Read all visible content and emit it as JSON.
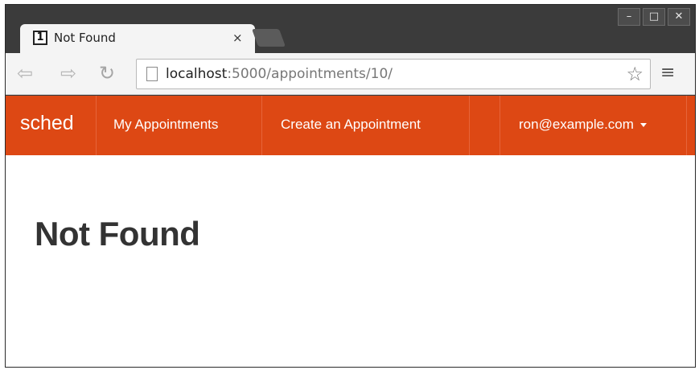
{
  "browser": {
    "tab": {
      "favicon": "1",
      "title": "Not Found",
      "close": "×"
    },
    "window_buttons": [
      "–",
      "□",
      "✕"
    ],
    "nav": {
      "back_icon": "back-icon",
      "forward_icon": "forward-icon",
      "reload_icon": "reload-icon"
    },
    "address": {
      "host": "localhost",
      "rest": ":5000/appointments/10/"
    },
    "bookmark_icon": "☆",
    "menu_icon": "≡"
  },
  "app": {
    "brand": "sched",
    "nav_links": [
      "My Appointments",
      "Create an Appointment"
    ],
    "user": "ron@example.com",
    "accent_color": "#dd4814"
  },
  "page": {
    "heading": "Not Found"
  }
}
